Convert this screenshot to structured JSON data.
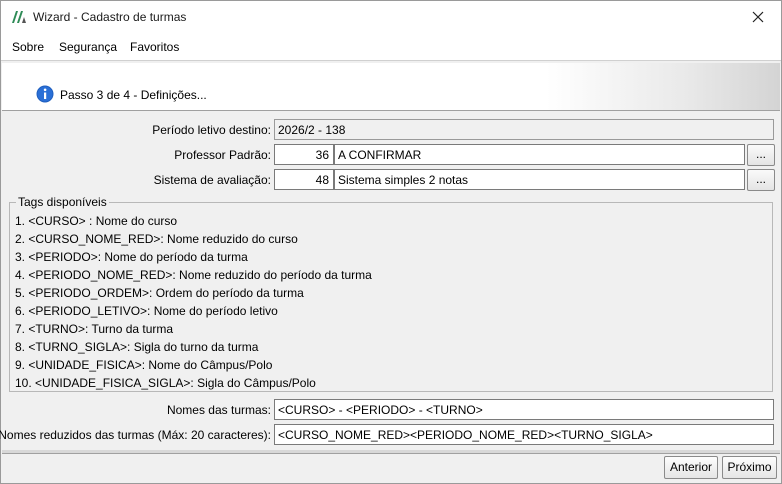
{
  "window": {
    "title": "Wizard - Cadastro de turmas"
  },
  "menu": {
    "items": [
      {
        "label": "Sobre"
      },
      {
        "label": "Segurança"
      },
      {
        "label": "Favoritos"
      }
    ]
  },
  "header": {
    "step_text": "Passo 3 de 4 - Definições..."
  },
  "form": {
    "periodo_label": "Período letivo destino:",
    "periodo_value": "2026/2 - 138",
    "professor_label": "Professor Padrão:",
    "professor_code": "36",
    "professor_name": "A CONFIRMAR",
    "sistema_label": "Sistema de avaliação:",
    "sistema_code": "48",
    "sistema_name": "Sistema simples 2 notas",
    "lookup_label": "..."
  },
  "tags": {
    "title": "Tags disponíveis",
    "items": [
      "1. <CURSO> : Nome do curso",
      "2. <CURSO_NOME_RED>: Nome reduzido do curso",
      "3. <PERIODO>: Nome do período da turma",
      "4. <PERIODO_NOME_RED>: Nome reduzido do período da turma",
      "5. <PERIODO_ORDEM>: Ordem do período da turma",
      "6. <PERIODO_LETIVO>: Nome do período letivo",
      "7. <TURNO>: Turno da turma",
      "8. <TURNO_SIGLA>: Sigla do turno da turma",
      "9. <UNIDADE_FISICA>: Nome do Câmpus/Polo",
      "10. <UNIDADE_FISICA_SIGLA>: Sigla do Câmpus/Polo"
    ]
  },
  "names": {
    "nomes_label": "Nomes das turmas:",
    "nomes_value": "<CURSO> - <PERIODO> - <TURNO>",
    "reduzidos_label": "Nomes reduzidos das turmas (Máx: 20 caracteres):",
    "reduzidos_value": "<CURSO_NOME_RED><PERIODO_NOME_RED><TURNO_SIGLA>"
  },
  "footer": {
    "anterior_label": "Anterior",
    "proximo_label": "Próximo"
  },
  "colors": {
    "info_blue": "#1f5fbf",
    "logo_green": "#2e8b57"
  },
  "icons": {
    "app": "app-logo-icon",
    "close": "close-icon",
    "info": "info-icon"
  }
}
